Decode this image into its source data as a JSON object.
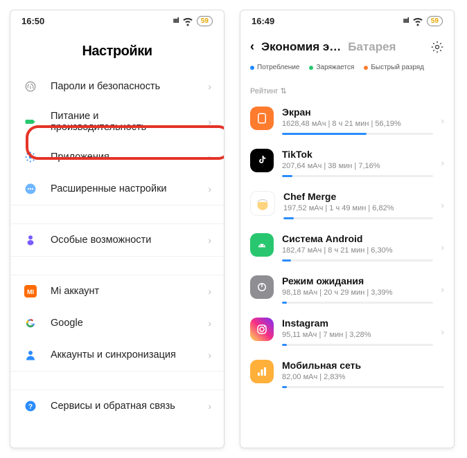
{
  "left": {
    "status": {
      "time": "16:50",
      "battery": "59"
    },
    "title": "Настройки",
    "rows": [
      {
        "id": "passwords",
        "label": "Пароли и безопасность"
      },
      {
        "id": "power",
        "label": "Питание и производительность"
      },
      {
        "id": "apps",
        "label": "Приложения"
      },
      {
        "id": "advanced",
        "label": "Расширенные настройки"
      },
      {
        "id": "special",
        "label": "Особые возможности"
      },
      {
        "id": "miacct",
        "label": "Mi аккаунт"
      },
      {
        "id": "google",
        "label": "Google"
      },
      {
        "id": "accounts",
        "label": "Аккаунты и синхронизация"
      },
      {
        "id": "services",
        "label": "Сервисы и обратная связь"
      }
    ]
  },
  "right": {
    "status": {
      "time": "16:49",
      "battery": "59"
    },
    "tabs": {
      "active": "Экономия э…",
      "inactive": "Батарея"
    },
    "legend": {
      "a": "Потребление",
      "b": "Заряжается",
      "c": "Быстрый разряд"
    },
    "rating_label": "Рейтинг ⇅",
    "apps": [
      {
        "name": "Экран",
        "sub": "1628,48 мАч | 8 ч 21 мин | 56,19%",
        "pct": 56
      },
      {
        "name": "TikTok",
        "sub": "207,64 мАч | 38 мин | 7,16%",
        "pct": 7
      },
      {
        "name": "Chef Merge",
        "sub": "197,52 мАч | 1 ч 49 мин | 6,82%",
        "pct": 7
      },
      {
        "name": "Система Android",
        "sub": "182,47 мАч | 8 ч 21 мин | 6,30%",
        "pct": 6
      },
      {
        "name": "Режим ожидания",
        "sub": "98,18 мАч | 20 ч 29 мин | 3,39%",
        "pct": 3
      },
      {
        "name": "Instagram",
        "sub": "95,11 мАч | 7 мин | 3,28%",
        "pct": 3
      },
      {
        "name": "Мобильная сеть",
        "sub": "82,00 мАч | 2,83%",
        "pct": 3
      }
    ]
  }
}
